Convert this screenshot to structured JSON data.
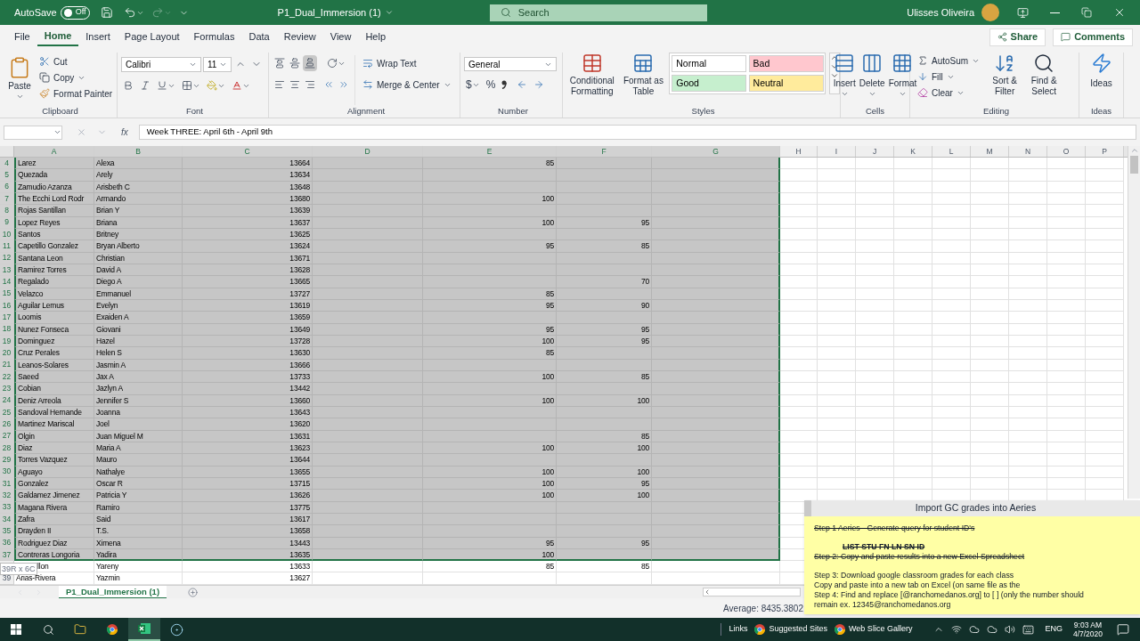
{
  "title_bar": {
    "autosave_label": "AutoSave",
    "autosave_state": "Off",
    "autosave_on": false,
    "file_name": "P1_Dual_Immersion (1)",
    "search_placeholder": "Search",
    "user_name": "Ulisses Oliveira"
  },
  "menu_tabs": [
    {
      "label": "File",
      "selected": false
    },
    {
      "label": "Home",
      "selected": true
    },
    {
      "label": "Insert",
      "selected": false
    },
    {
      "label": "Page Layout",
      "selected": false
    },
    {
      "label": "Formulas",
      "selected": false
    },
    {
      "label": "Data",
      "selected": false
    },
    {
      "label": "Review",
      "selected": false
    },
    {
      "label": "View",
      "selected": false
    },
    {
      "label": "Help",
      "selected": false
    }
  ],
  "share_button": "Share",
  "comments_button": "Comments",
  "ribbon": {
    "clipboard": {
      "label": "Clipboard",
      "paste": "Paste",
      "cut": "Cut",
      "copy": "Copy",
      "format_painter": "Format Painter"
    },
    "font": {
      "label": "Font",
      "font_name": "Calibri",
      "font_size": "11"
    },
    "alignment": {
      "label": "Alignment",
      "wrap_text": "Wrap Text",
      "merge_center": "Merge & Center"
    },
    "number": {
      "label": "Number",
      "format": "General",
      "currency": "$",
      "percent": "%"
    },
    "styles": {
      "label": "Styles",
      "conditional_formatting": "Conditional Formatting",
      "format_as_table": "Format as Table",
      "cell_styles": [
        {
          "label": "Normal",
          "color": "#ffffff"
        },
        {
          "label": "Bad",
          "color": "#ffc7ce"
        },
        {
          "label": "Good",
          "color": "#c6efce"
        },
        {
          "label": "Neutral",
          "color": "#ffeb9c"
        }
      ]
    },
    "cells": {
      "label": "Cells",
      "insert": "Insert",
      "delete": "Delete",
      "format": "Format"
    },
    "editing": {
      "label": "Editing",
      "autosum": "AutoSum",
      "fill": "Fill",
      "clear": "Clear",
      "sort_filter": "Sort & Filter",
      "find_select": "Find & Select"
    },
    "ideas": {
      "label": "Ideas",
      "button": "Ideas"
    }
  },
  "formula_bar": {
    "function_label": "fx",
    "formula": "Week THREE: April 6th - April 9th"
  },
  "sheet": {
    "columns": [
      {
        "label": "A",
        "selected": true
      },
      {
        "label": "B",
        "selected": true
      },
      {
        "label": "C",
        "selected": true
      },
      {
        "label": "D",
        "selected": true
      },
      {
        "label": "E",
        "selected": true
      },
      {
        "label": "F",
        "selected": true
      },
      {
        "label": "G",
        "selected": true
      },
      {
        "label": "H",
        "selected": false
      },
      {
        "label": "I",
        "selected": false
      },
      {
        "label": "J",
        "selected": false
      },
      {
        "label": "K",
        "selected": false
      },
      {
        "label": "L",
        "selected": false
      },
      {
        "label": "M",
        "selected": false
      },
      {
        "label": "N",
        "selected": false
      },
      {
        "label": "O",
        "selected": false
      },
      {
        "label": "P",
        "selected": false
      }
    ],
    "rows": [
      {
        "number": "4",
        "selected": true,
        "column_a": "Larez",
        "column_b": "Alexa",
        "column_c": "13664",
        "column_e": "85"
      },
      {
        "number": "5",
        "selected": true,
        "column_a": "Quezada",
        "column_b": "Arely",
        "column_c": "13634"
      },
      {
        "number": "6",
        "selected": true,
        "column_a": "Zamudio Azanza",
        "column_b": "Arisbeth C",
        "column_c": "13648"
      },
      {
        "number": "7",
        "selected": true,
        "column_a": "The Ecchi Lord Rodr",
        "column_b": "Armando",
        "column_c": "13680",
        "column_e": "100"
      },
      {
        "number": "8",
        "selected": true,
        "column_a": "Rojas Santillan",
        "column_b": "Brian Y",
        "column_c": "13639"
      },
      {
        "number": "9",
        "selected": true,
        "column_a": "Lopez Reyes",
        "column_b": "Briana",
        "column_c": "13637",
        "column_e": "100",
        "column_f": "95"
      },
      {
        "number": "10",
        "selected": true,
        "column_a": "Santos",
        "column_b": "Britney",
        "column_c": "13625"
      },
      {
        "number": "11",
        "selected": true,
        "column_a": "Capetillo Gonzalez",
        "column_b": "Bryan Alberto",
        "column_c": "13624",
        "column_e": "95",
        "column_f": "85"
      },
      {
        "number": "12",
        "selected": true,
        "column_a": "Santana Leon",
        "column_b": "Christian",
        "column_c": "13671"
      },
      {
        "number": "13",
        "selected": true,
        "column_a": "Ramirez Torres",
        "column_b": "David A",
        "column_c": "13628"
      },
      {
        "number": "14",
        "selected": true,
        "column_a": "Regalado",
        "column_b": "Diego A",
        "column_c": "13665",
        "column_f": "70"
      },
      {
        "number": "15",
        "selected": true,
        "column_a": "Velazco",
        "column_b": "Emmanuel",
        "column_c": "13727",
        "column_e": "85"
      },
      {
        "number": "16",
        "selected": true,
        "column_a": "Aguilar Lemus",
        "column_b": "Evelyn",
        "column_c": "13619",
        "column_e": "95",
        "column_f": "90"
      },
      {
        "number": "17",
        "selected": true,
        "column_a": "Loomis",
        "column_b": "Exaiden A",
        "column_c": "13659"
      },
      {
        "number": "18",
        "selected": true,
        "column_a": "Nunez Fonseca",
        "column_b": "Giovani",
        "column_c": "13649",
        "column_e": "95",
        "column_f": "95"
      },
      {
        "number": "19",
        "selected": true,
        "column_a": "Dominguez",
        "column_b": "Hazel",
        "column_c": "13728",
        "column_e": "100",
        "column_f": "95"
      },
      {
        "number": "20",
        "selected": true,
        "column_a": "Cruz Perales",
        "column_b": "Helen S",
        "column_c": "13630",
        "column_e": "85"
      },
      {
        "number": "21",
        "selected": true,
        "column_a": "Leanos-Solares",
        "column_b": "Jasmin A",
        "column_c": "13666"
      },
      {
        "number": "22",
        "selected": true,
        "column_a": "Saeed",
        "column_b": "Jax A",
        "column_c": "13733",
        "column_e": "100",
        "column_f": "85"
      },
      {
        "number": "23",
        "selected": true,
        "column_a": "Cobian",
        "column_b": "Jazlyn A",
        "column_c": "13442"
      },
      {
        "number": "24",
        "selected": true,
        "column_a": "Deniz Arreola",
        "column_b": "Jennifer S",
        "column_c": "13660",
        "column_e": "100",
        "column_f": "100"
      },
      {
        "number": "25",
        "selected": true,
        "column_a": "Sandoval Hernande",
        "column_b": "Joanna",
        "column_c": "13643"
      },
      {
        "number": "26",
        "selected": true,
        "column_a": "Martinez Mariscal",
        "column_b": "Joel",
        "column_c": "13620"
      },
      {
        "number": "27",
        "selected": true,
        "column_a": "Olgin",
        "column_b": "Juan Miguel M",
        "column_c": "13631",
        "column_f": "85"
      },
      {
        "number": "28",
        "selected": true,
        "column_a": "Diaz",
        "column_b": "Maria A",
        "column_c": "13623",
        "column_e": "100",
        "column_f": "100"
      },
      {
        "number": "29",
        "selected": true,
        "column_a": "Torres Vazquez",
        "column_b": "Mauro",
        "column_c": "13644"
      },
      {
        "number": "30",
        "selected": true,
        "column_a": "Aguayo",
        "column_b": "Nathalye",
        "column_c": "13655",
        "column_e": "100",
        "column_f": "100"
      },
      {
        "number": "31",
        "selected": true,
        "column_a": "Gonzalez",
        "column_b": "Oscar R",
        "column_c": "13715",
        "column_e": "100",
        "column_f": "95"
      },
      {
        "number": "32",
        "selected": true,
        "column_a": "Galdamez Jimenez",
        "column_b": "Patricia Y",
        "column_c": "13626",
        "column_e": "100",
        "column_f": "100"
      },
      {
        "number": "33",
        "selected": true,
        "column_a": "Magana Rivera",
        "column_b": "Ramiro",
        "column_c": "13775"
      },
      {
        "number": "34",
        "selected": true,
        "column_a": "Zafra",
        "column_b": "Said",
        "column_c": "13617"
      },
      {
        "number": "35",
        "selected": true,
        "column_a": "Drayden II",
        "column_b": "T.S.",
        "column_c": "13658"
      },
      {
        "number": "36",
        "selected": true,
        "column_a": "Rodriguez Diaz",
        "column_b": "Ximena",
        "column_c": "13443",
        "column_e": "95",
        "column_f": "95"
      },
      {
        "number": "37",
        "selected": true,
        "column_a": "Contreras Longoria",
        "column_b": "Yadira",
        "column_c": "13635",
        "column_e": "100"
      },
      {
        "selected": false,
        "column_a": "llon",
        "column_b": "Yareny",
        "column_c": "13633",
        "column_e": "85",
        "column_f": "85"
      },
      {
        "number": "39",
        "selected": false,
        "column_a": "Arias-Rivera",
        "column_b": "Yazmin",
        "column_c": "13627"
      }
    ],
    "size_tooltip": "39R x 6C"
  },
  "sheet_tabs": [
    {
      "label": "P1_Dual_Immersion (1)",
      "selected": true
    }
  ],
  "status_bar": {
    "average": "Average: 8435.3802"
  },
  "note": {
    "title": "Import GC grades into Aeries",
    "paragraphs": [
      {
        "lines": [
          {
            "text": "Step 1 Aeries - Generate query for student ID's",
            "struck": true,
            "bold": false
          }
        ]
      },
      {
        "lines": [
          {
            "text": "LIST STU FN LN SN ID",
            "struck": true,
            "bold": true
          },
          {
            "text": "Step 2: Copy and paste results into a new Excel Spreadsheet",
            "struck": true,
            "bold": false
          }
        ]
      },
      {
        "lines": [
          {
            "text": "Step 3: Download google classroom grades for each class",
            "struck": false,
            "bold": false
          },
          {
            "text": "Copy and paste into a new tab on Excel (on same file as the",
            "struck": false,
            "bold": false
          },
          {
            "text": "Step 4: Find and replace [@ranchomedanos.org] to [ ] (only the number should",
            "struck": false,
            "bold": false
          },
          {
            "text": "remain ex. 12345@ranchomedanos.org",
            "struck": false,
            "bold": false
          }
        ]
      }
    ]
  },
  "taskbar": {
    "links": "Links",
    "favorites": [
      "Suggested Sites",
      "Web Slice Gallery"
    ],
    "language": "ENG",
    "time": "9:03 AM",
    "date": "4/7/2020"
  }
}
